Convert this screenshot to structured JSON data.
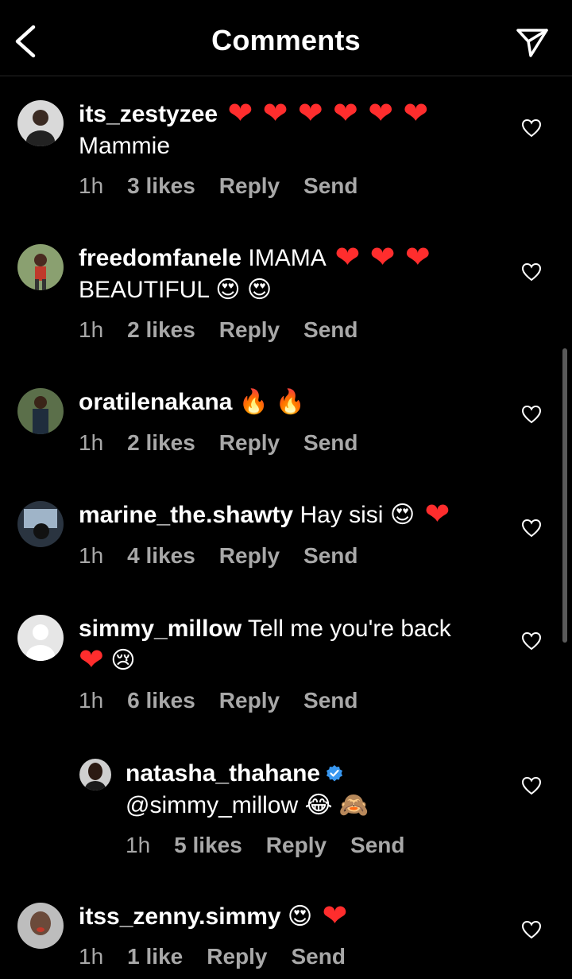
{
  "header": {
    "title": "Comments"
  },
  "comments": [
    {
      "username": "its_zestyzee",
      "text": "",
      "line2": "Mammie",
      "time": "1h",
      "likes": "3 likes",
      "reply": "Reply",
      "send": "Send"
    },
    {
      "username": "freedomfanele",
      "text": "IMAMA",
      "line2": "BEAUTIFUL",
      "time": "1h",
      "likes": "2 likes",
      "reply": "Reply",
      "send": "Send"
    },
    {
      "username": "oratilenakana",
      "text": "",
      "time": "1h",
      "likes": "2 likes",
      "reply": "Reply",
      "send": "Send"
    },
    {
      "username": "marine_the.shawty",
      "text": "Hay sisi",
      "time": "1h",
      "likes": "4 likes",
      "reply": "Reply",
      "send": "Send"
    },
    {
      "username": "simmy_millow",
      "text": "Tell me you're back",
      "time": "1h",
      "likes": "6 likes",
      "reply": "Reply",
      "send": "Send"
    },
    {
      "username": "natasha_thahane",
      "text": "@simmy_millow",
      "time": "1h",
      "likes": "5 likes",
      "reply": "Reply",
      "send": "Send",
      "verified": true
    },
    {
      "username": "itss_zenny.simmy",
      "text": "",
      "time": "1h",
      "likes": "1 like",
      "reply": "Reply",
      "send": "Send"
    }
  ],
  "emojis": {
    "red_heart": "❤",
    "heart_eyes": "😍",
    "fire": "🔥",
    "crying": "😢",
    "joy": "😂",
    "see_no_evil": "🙈"
  },
  "colors": {
    "heart": "#ff2d2d",
    "verified": "#3897f0",
    "meta": "#a8a8a8"
  }
}
